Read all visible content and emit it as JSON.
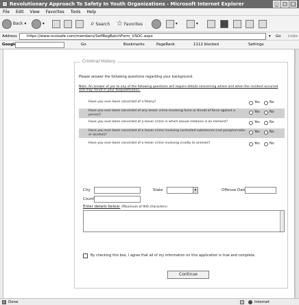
{
  "window": {
    "title": "Revolutionary Approach To Safety In Youth Organizations - Microsoft Internet Explorer"
  },
  "menu": [
    "File",
    "Edit",
    "View",
    "Favorites",
    "Tools",
    "Help"
  ],
  "toolbar": {
    "back": "Back",
    "search": "Search",
    "favorites": "Favorites"
  },
  "address": {
    "label": "Address",
    "url": "https://www.ncsisafe.com/members/SelfRegBatchForm_USOC.aspx",
    "go": "Go",
    "links": "Links"
  },
  "google_bar": {
    "label": "Google",
    "go": "Go",
    "bookmarks": "Bookmarks",
    "pagerank": "PageRank",
    "blocked": "1112 blocked",
    "settings": "Settings"
  },
  "form": {
    "legend": "Criminal History",
    "intro": "Please answer the following questions regarding your background.",
    "note": "Note: An answer of yes to any of the following questions will require details concerning where and when the incident occurred and may result in your disqualification.",
    "questions": [
      {
        "text": "Have you ever been convicted of a felony?",
        "yes": "Yes",
        "no": "No"
      },
      {
        "text": "Have you ever been convicted of any lesser crime involving force or threat of force against a person?",
        "yes": "Yes",
        "no": "No"
      },
      {
        "text": "Have you ever been convicted of a lesser crime in which sexual relations is an element?",
        "yes": "Yes",
        "no": "No"
      },
      {
        "text": "Have you ever been convicted of a lesser crime involving controlled substances (not paraphernalia or alcohol)?",
        "yes": "Yes",
        "no": "No"
      },
      {
        "text": "Have you ever been convicted of a lesser crime involving cruelty to animals?",
        "yes": "Yes",
        "no": "No"
      }
    ],
    "city_label": "City",
    "state_label": "State",
    "offense_date_label": "Offense Date",
    "county_label": "County",
    "details_label": "Enter details below:",
    "details_hint": "(Maximum of 900 characters)",
    "agree_text": "By checking this box, I agree that all of my information on this application is true and complete.",
    "continue_label": "Continue"
  },
  "status": {
    "left": "Done",
    "zone": "Internet"
  }
}
